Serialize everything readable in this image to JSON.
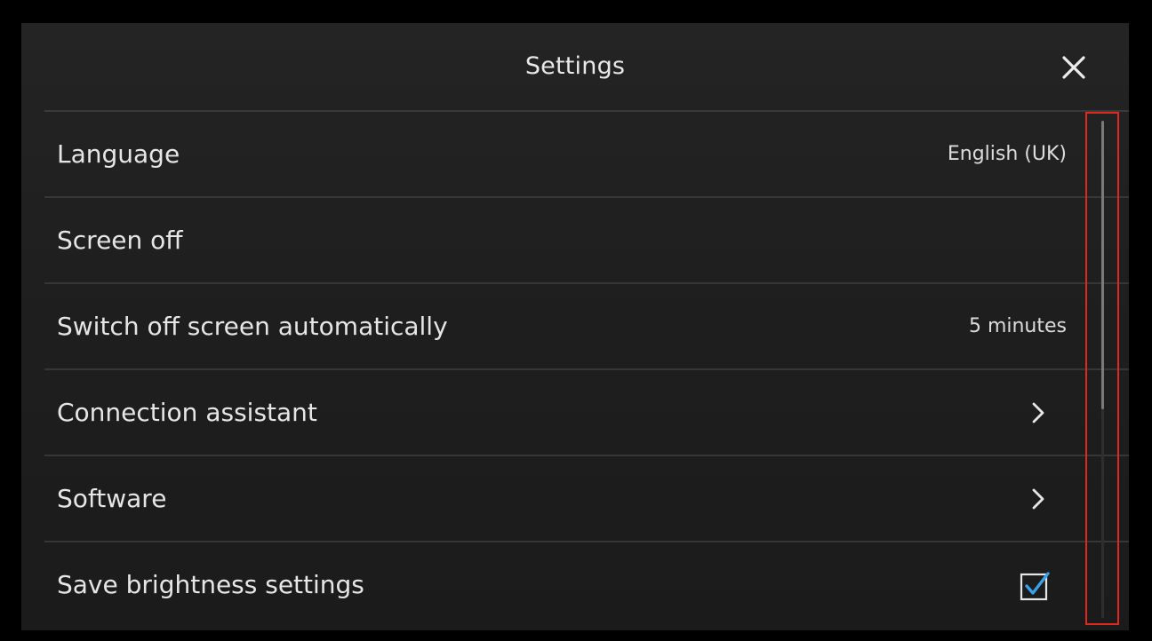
{
  "header": {
    "title": "Settings",
    "close_icon": "close-icon"
  },
  "settings": [
    {
      "label": "Language",
      "value": "English (UK)",
      "control": "value"
    },
    {
      "label": "Screen off",
      "value": "",
      "control": "none"
    },
    {
      "label": "Switch off screen automatically",
      "value": "5 minutes",
      "control": "value"
    },
    {
      "label": "Connection assistant",
      "value": "",
      "control": "chevron-right-icon"
    },
    {
      "label": "Software",
      "value": "",
      "control": "chevron-right-icon"
    },
    {
      "label": "Save brightness settings",
      "value": "",
      "control": "checkbox",
      "checked": true
    }
  ],
  "scrollbar": {
    "position_fraction": 0.0,
    "visible_fraction": 0.58,
    "highlighted": true
  },
  "colors": {
    "background": "#1f1f1f",
    "text": "#e6e6e6",
    "divider": "#363636",
    "checkbox_check": "#3aa0e8",
    "highlight_border": "#e0291c"
  }
}
